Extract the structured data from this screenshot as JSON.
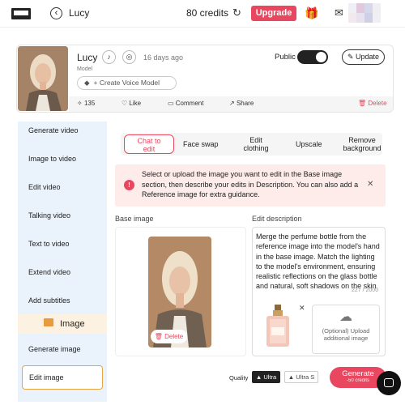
{
  "topbar": {
    "user": "Lucy",
    "credits": "80 credits",
    "upgrade": "Upgrade"
  },
  "model": {
    "name": "Lucy",
    "time_ago": "16 days ago",
    "label": "Model",
    "voice_button": "+ Create Voice Model",
    "public_label": "Public",
    "update": "Update",
    "views": "135",
    "like": "Like",
    "comment": "Comment",
    "share": "Share",
    "delete": "Delete"
  },
  "sidebar": {
    "items": [
      "Generate video",
      "Image to video",
      "Edit video",
      "Talking video",
      "Text to video",
      "Extend video",
      "Add subtitles"
    ],
    "section": "Image",
    "generate_image": "Generate image",
    "edit_image": "Edit image"
  },
  "tabs": {
    "chat_edit_1": "Chat to",
    "chat_edit_2": "edit",
    "face_swap": "Face swap",
    "edit_clothing_1": "Edit",
    "edit_clothing_2": "clothing",
    "upscale": "Upscale",
    "remove_bg_1": "Remove",
    "remove_bg_2": "background"
  },
  "info": {
    "text": "Select or upload the image you want to edit in the Base image section, then describe your edits in Description. You can also add a Reference image for extra guidance."
  },
  "base": {
    "label": "Base image",
    "delete": "Delete"
  },
  "desc": {
    "label": "Edit description",
    "text": "Merge the perfume bottle from the reference image into the model's hand in the base image. Match the lighting to the model's environment, ensuring realistic reflections on the glass bottle and natural, soft shadows on the skin",
    "counter": "227 / 2000",
    "upload_1": "(Optional) Upload",
    "upload_2": "additional image"
  },
  "bottom": {
    "quality": "Quality",
    "ultra": "Ultra",
    "ultra_s": "Ultra S",
    "generate": "Generate",
    "generate_sub": "-50 credits"
  },
  "colors": {
    "accent": "#e8475f",
    "sidebar": "#eaf2fb",
    "image_section": "#fdf2e2"
  }
}
